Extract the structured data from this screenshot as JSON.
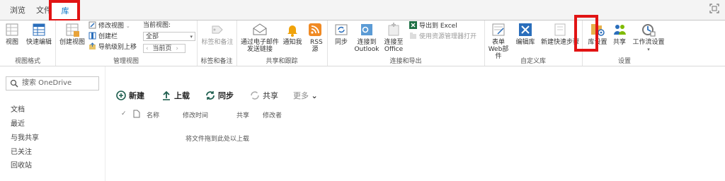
{
  "tabs": {
    "browse": "浏览",
    "file": "文件",
    "library": "库"
  },
  "ribbon": {
    "view_format": {
      "label": "视图格式",
      "view": "视图",
      "quick_edit": "快速编辑"
    },
    "manage_views": {
      "label": "管理视图",
      "create_view": "创建视图",
      "modify_view": "修改视图",
      "create_column": "创建栏",
      "navigate_up": "导航级别上移",
      "current_view_label": "当前视图:",
      "current_view_value": "全部",
      "current_page": "当前页"
    },
    "tags": {
      "label": "标签和备注",
      "tags_notes": "标签和备注"
    },
    "share_track": {
      "label": "共享和跟踪",
      "email_link": "通过电子邮件发送链接",
      "alert_me": "通知我",
      "rss": "RSS源"
    },
    "connect_export": {
      "label": "连接和导出",
      "sync": "同步",
      "connect_outlook": "连接到Outlook",
      "connect_office": "连接至Office",
      "export_excel": "导出到 Excel",
      "open_explorer": "使用资源管理器打开"
    },
    "customize": {
      "label": "自定义库",
      "form_web_parts": "表单 Web部件",
      "edit_library": "编辑库",
      "new_quick_step": "新建快速步骤"
    },
    "settings": {
      "label": "设置",
      "library_settings": "库设置",
      "share": "共享",
      "workflow_settings": "工作流设置"
    }
  },
  "leftnav": {
    "search_placeholder": "搜索 OneDrive",
    "items": [
      "文档",
      "最近",
      "与我共享",
      "已关注",
      "回收站"
    ]
  },
  "commands": {
    "new": "新建",
    "upload": "上载",
    "sync": "同步",
    "share": "共享",
    "more": "更多"
  },
  "columns": {
    "name": "名称",
    "modified": "修改时间",
    "sharing": "共享",
    "modified_by": "修改者"
  },
  "empty_message": "将文件拖到此处以上载",
  "colors": {
    "accent": "#0072c6",
    "highlight": "#e11414",
    "green": "#1e7145"
  }
}
